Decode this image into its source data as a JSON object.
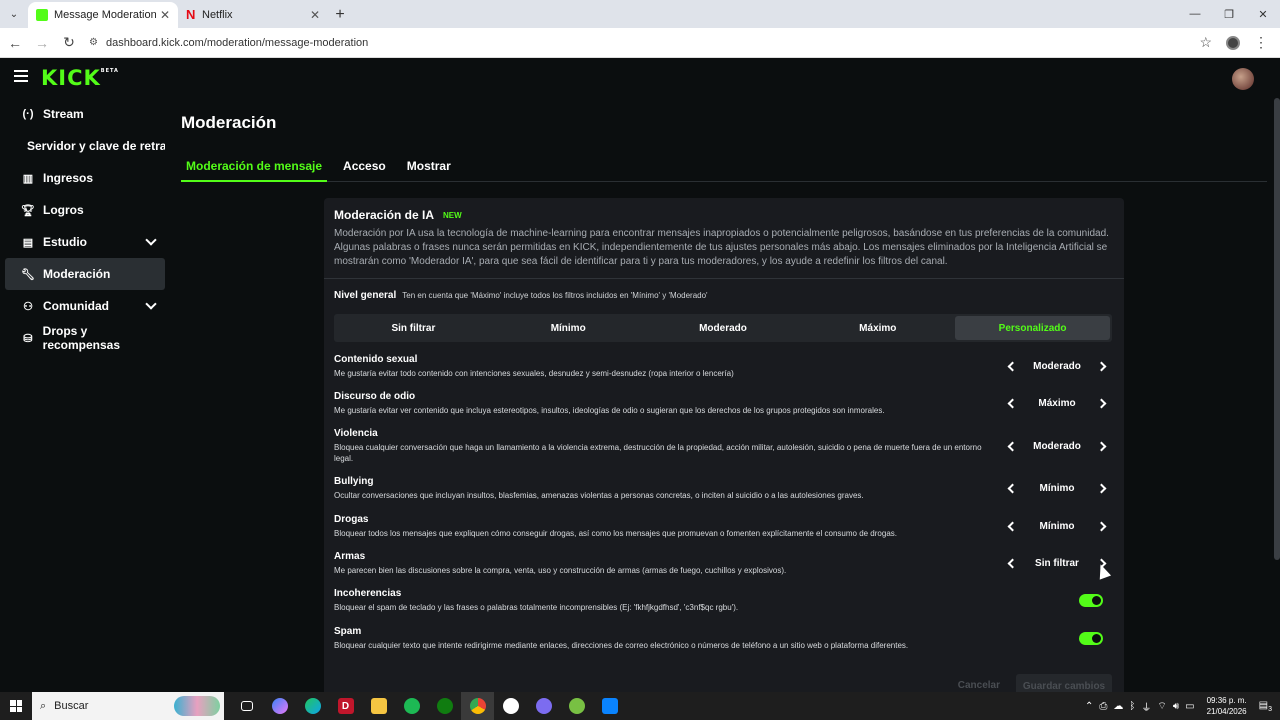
{
  "browser": {
    "tabs": [
      {
        "title": "Message Moderation - Kick Da",
        "favicon": "kick-icon",
        "active": true
      },
      {
        "title": "Netflix",
        "favicon": "netflix-icon",
        "active": false
      }
    ],
    "url": "dashboard.kick.com/moderation/message-moderation"
  },
  "header": {
    "logo": "KICK",
    "logo_badge": "BETA"
  },
  "sidebar": {
    "items": [
      {
        "label": "Stream",
        "icon": "broadcast-icon"
      },
      {
        "label": "Servidor y clave de retransn",
        "icon": ""
      },
      {
        "label": "Ingresos",
        "icon": "chart-icon"
      },
      {
        "label": "Logros",
        "icon": "trophy-icon"
      },
      {
        "label": "Estudio",
        "icon": "studio-icon"
      },
      {
        "label": "Moderación",
        "icon": "wrench-icon"
      },
      {
        "label": "Comunidad",
        "icon": "community-icon"
      },
      {
        "label": "Drops y recompensas",
        "icon": "drops-icon"
      }
    ]
  },
  "main": {
    "title": "Moderación",
    "tabs": [
      "Moderación de mensaje",
      "Acceso",
      "Mostrar"
    ]
  },
  "ai_moderation": {
    "title": "Moderación de IA",
    "badge": "NEW",
    "description": "Moderación por IA usa la tecnología de machine-learning para encontrar mensajes inapropiados o potencialmente peligrosos, basándose en tus preferencias de la comunidad. Algunas palabras o frases nunca serán permitidas en KICK, independientemente de tus ajustes personales más abajo. Los mensajes eliminados por la Inteligencia Artificial se mostrarán como 'Moderador IA', para que sea fácil de identificar para ti y para tus moderadores, y los ayude a redefinir los filtros del canal.",
    "level_label": "Nivel general",
    "level_hint": "Ten en cuenta que 'Máximo' incluye todos los filtros incluidos en 'Mínimo' y 'Moderado'",
    "levels": [
      "Sin filtrar",
      "Mínimo",
      "Moderado",
      "Máximo",
      "Personalizado"
    ],
    "selected_level": "Personalizado",
    "rules": [
      {
        "title": "Contenido sexual",
        "desc": "Me gustaría evitar todo contenido con intenciones sexuales, desnudez y semi-desnudez (ropa interior o lencería)",
        "value": "Moderado"
      },
      {
        "title": "Discurso de odio",
        "desc": "Me gustaría evitar ver contenido que incluya estereotipos, insultos, ideologías de odio o sugieran que los derechos de los grupos protegidos son inmorales.",
        "value": "Máximo"
      },
      {
        "title": "Violencia",
        "desc": "Bloquea cualquier conversación que haga un llamamiento a la violencia extrema, destrucción de la propiedad, acción militar, autolesión, suicidio o pena de muerte fuera de un entorno legal.",
        "value": "Moderado"
      },
      {
        "title": "Bullying",
        "desc": "Ocultar conversaciones que incluyan insultos, blasfemias, amenazas violentas a personas concretas, o inciten al suicidio o a las autolesiones graves.",
        "value": "Mínimo"
      },
      {
        "title": "Drogas",
        "desc": "Bloquear todos los mensajes que expliquen cómo conseguir drogas, así como los mensajes que promuevan o fomenten explícitamente el consumo de drogas.",
        "value": "Mínimo"
      },
      {
        "title": "Armas",
        "desc": "Me parecen bien las discusiones sobre la compra, venta, uso y construcción de armas (armas de fuego, cuchillos y explosivos).",
        "value": "Sin filtrar"
      }
    ],
    "toggles": [
      {
        "title": "Incoherencias",
        "desc": "Bloquear el spam de teclado y las frases o palabras totalmente incomprensibles (Ej: 'fkhfjkgdfhsd', 'c3nf$qc rgbu').",
        "on": true
      },
      {
        "title": "Spam",
        "desc": "Bloquear cualquier texto que intente redirigirme mediante enlaces, direcciones de correo electrónico o números de teléfono a un sitio web o plataforma diferentes.",
        "on": true
      }
    ],
    "cancel_label": "Cancelar",
    "save_label": "Guardar cambios"
  },
  "taskbar": {
    "search_placeholder": "Buscar",
    "time": "09:36 p. m.",
    "date": "21/04/2026",
    "notification_count": "3"
  },
  "colors": {
    "accent": "#53fc18",
    "background": "#0b0e0f",
    "card": "#191b1f"
  }
}
